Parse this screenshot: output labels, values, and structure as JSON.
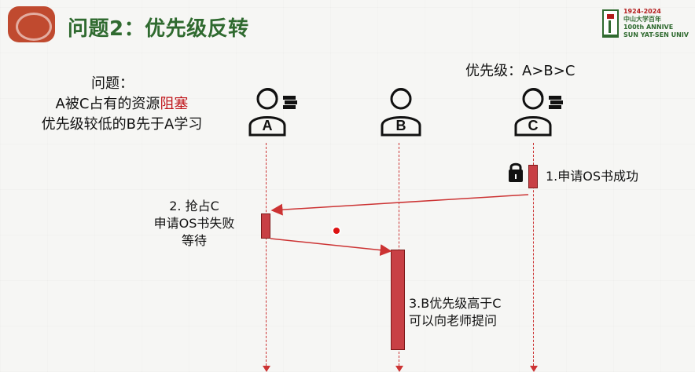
{
  "header": {
    "title": "问题2：优先级反转",
    "top_right_logo_text": [
      "1924-2024",
      "中山大学百年",
      "100th ANNIVE",
      "SUN YAT-SEN UNIV"
    ]
  },
  "problem": {
    "label": "问题：",
    "line2_prefix": "A被C占有的资源",
    "line2_highlight": "阻塞",
    "line3": "优先级较低的B先于A学习"
  },
  "priority_label": "优先级：A>B>C",
  "actors": [
    {
      "name": "A",
      "has_books": true
    },
    {
      "name": "B",
      "has_books": false
    },
    {
      "name": "C",
      "has_books": true
    }
  ],
  "messages": {
    "m1": "1.申请OS书成功",
    "m2_l1": "2. 抢占C",
    "m2_l2": "申请OS书失败",
    "m2_l3": "等待",
    "m3_l1": "3.B优先级高于C",
    "m3_l2": "可以向老师提问"
  },
  "icons": {
    "lock": "lock-icon",
    "books": "books-icon"
  },
  "colors": {
    "title_green": "#2f6a2f",
    "accent_red": "#c0161b",
    "bar_red": "#c84045",
    "lifeline_red": "#c33"
  }
}
